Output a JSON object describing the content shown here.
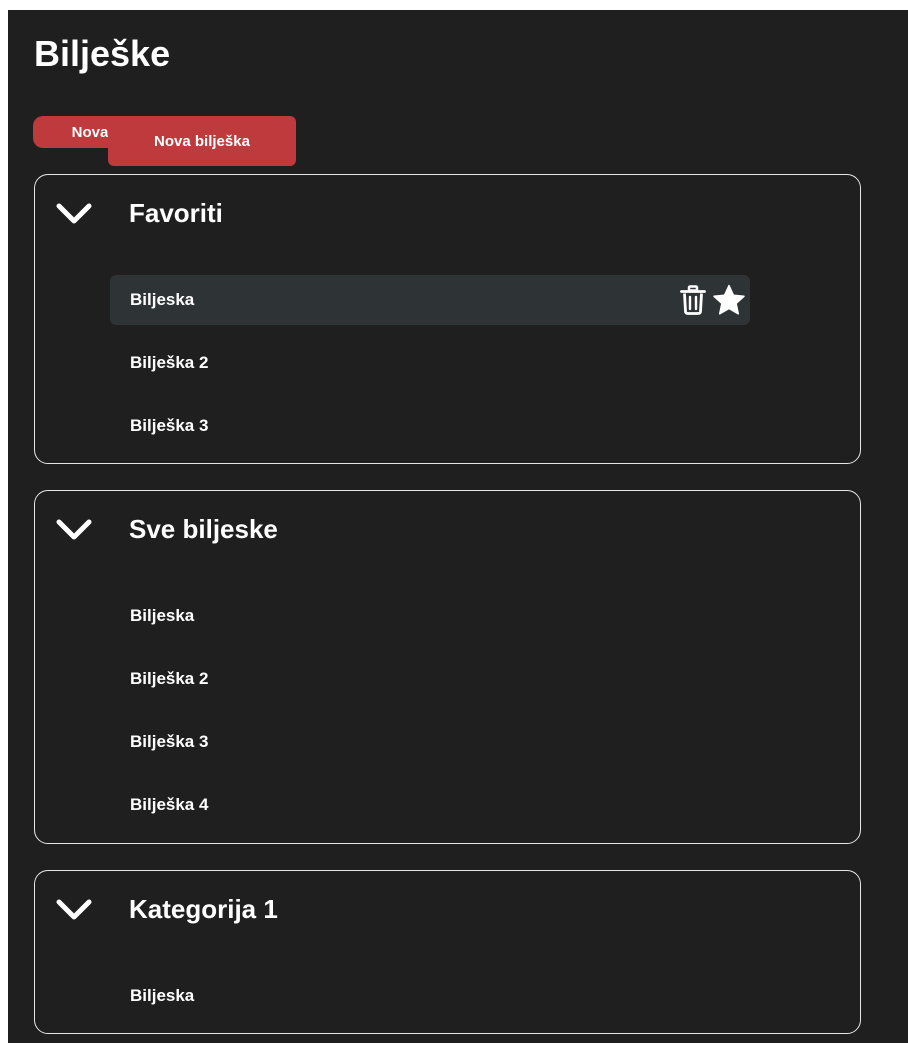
{
  "page": {
    "title": "Bilješke"
  },
  "toolbar": {
    "new_category_label": "Nova kategorija",
    "new_note_label": "Nova bilješka"
  },
  "categories": [
    {
      "title": "Favoriti",
      "notes": [
        "Biljeska",
        "Bilješka 2",
        "Bilješka 3"
      ]
    },
    {
      "title": "Sve biljeske",
      "notes": [
        "Biljeska",
        "Bilješka 2",
        "Bilješka 3",
        "Bilješka 4"
      ]
    },
    {
      "title": "Kategorija 1",
      "notes": [
        "Biljeska"
      ]
    }
  ],
  "icons": {
    "expand": "chevron-down-icon",
    "delete": "trash-icon",
    "favorite": "star-icon"
  },
  "colors": {
    "background": "#1f1f1f",
    "accent": "#bf3a3d",
    "hover_row": "#2e3336",
    "border": "#e6e6e6",
    "text": "#ffffff"
  }
}
